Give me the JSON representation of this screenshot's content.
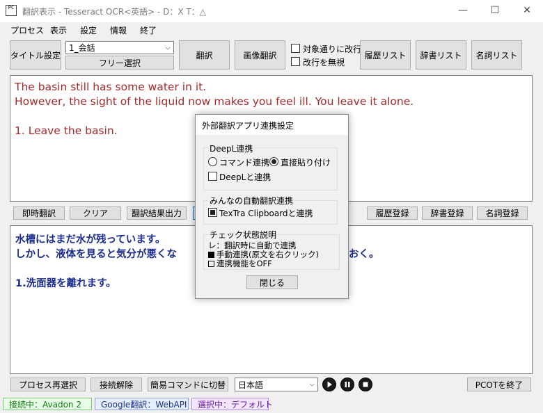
{
  "window": {
    "title": "翻訳表示 - Tesseract OCR<英語> - D：X T：△",
    "icon_glyph": "PC",
    "minimize": "—",
    "maximize": "☐",
    "close": "✕"
  },
  "menu": [
    "プロセス",
    "表示",
    "設定",
    "情報",
    "終了"
  ],
  "toolbar": {
    "title_setting": "タイトル設定",
    "scene_select_value": "1_会話",
    "free_select": "フリー選択",
    "translate": "翻訳",
    "image_translate": "画像翻訳",
    "chk_newline_label": "対象通りに改行",
    "chk_ignore_newline_label": "改行を無視",
    "history_list": "履歴リスト",
    "dictionary_list": "辞書リスト",
    "noun_list": "名詞リスト"
  },
  "source_text": [
    "The basin still has some water in it.",
    "However, the sight of the liquid now makes you feel ill. You leave it alone.",
    "",
    "1. Leave the basin."
  ],
  "mid_buttons": {
    "instant_translate": "即時翻訳",
    "clear": "クリア",
    "output_result": "翻訳結果出力",
    "history_register": "履歴登録",
    "dictionary_register": "辞書登録",
    "noun_register": "名詞登録"
  },
  "translated_text": {
    "line1": "水槽にはまだ水が残っています。",
    "line2_left": "しかし、液体を見ると気分が悪くな",
    "line2_right": "おく。",
    "line4": "1.洗面器を離れます。"
  },
  "bottom": {
    "process_reselect": "プロセス再選択",
    "disconnect": "接続解除",
    "simple_command": "簡易コマンドに切替",
    "language_value": "日本語",
    "quit": "PCOTを終了"
  },
  "status": {
    "connection": "接続中：Avadon 2",
    "google": "Google翻訳：WebAPI",
    "selected": "選択中：デフォルト"
  },
  "dialog": {
    "title": "外部翻訳アプリ連携設定",
    "deepl_group": "DeepL連携",
    "radio_command": "コマンド連携",
    "radio_direct_paste": "直接貼り付け",
    "chk_deepl": "DeepLと連携",
    "minna_group": "みんなの自動翻訳連携",
    "chk_textra": "TexTra Clipboardと連携",
    "legend_group": "チェック状態説明",
    "legend_line1": "レ：翻訳時に自動で連携",
    "legend_line2": "手動連携(原文を右クリック)",
    "legend_line3": "連携機能をOFF",
    "close_button": "閉じる"
  },
  "colors": {
    "source_text": "#a52a2a",
    "translated_text": "#1c2c8c",
    "status_connection_bg": "#e6ffe6",
    "status_google_bg": "#e6eeff",
    "status_selected_bg": "#f2e6ff"
  }
}
